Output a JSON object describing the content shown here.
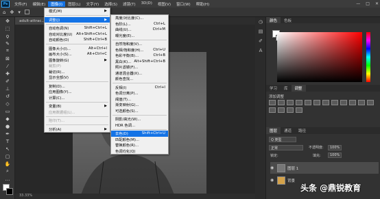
{
  "menubar": {
    "app_icon": "Ps",
    "items": [
      "文件(F)",
      "编辑(E)",
      "图像(I)",
      "图层(L)",
      "文字(Y)",
      "选择(S)",
      "滤镜(T)",
      "3D(D)",
      "视图(V)",
      "窗口(W)",
      "帮助(H)"
    ],
    "active_index": 2,
    "window_controls": [
      "—",
      "□",
      "✕"
    ]
  },
  "document": {
    "tab_label": "adult-attrac...",
    "status": "33.33%"
  },
  "image_menu": [
    {
      "label": "模式(M)",
      "submenu": true
    },
    {
      "sep": true
    },
    {
      "label": "调整(J)",
      "submenu": true,
      "selected": true
    },
    {
      "sep": true
    },
    {
      "label": "自动色调(N)",
      "key": "Shift+Ctrl+L"
    },
    {
      "label": "自动对比度(U)",
      "key": "Alt+Shift+Ctrl+L"
    },
    {
      "label": "自动颜色(O)",
      "key": "Shift+Ctrl+B"
    },
    {
      "sep": true
    },
    {
      "label": "图像大小(I)...",
      "key": "Alt+Ctrl+I"
    },
    {
      "label": "画布大小(S)...",
      "key": "Alt+Ctrl+C"
    },
    {
      "label": "图像旋转(G)",
      "submenu": true
    },
    {
      "label": "裁剪(P)",
      "disabled": true
    },
    {
      "label": "裁切(R)..."
    },
    {
      "label": "显示全部(V)"
    },
    {
      "sep": true
    },
    {
      "label": "复制(D)..."
    },
    {
      "label": "应用图像(Y)..."
    },
    {
      "label": "计算(C)..."
    },
    {
      "sep": true
    },
    {
      "label": "变量(B)",
      "submenu": true
    },
    {
      "label": "应用数据组(L)...",
      "disabled": true
    },
    {
      "sep": true
    },
    {
      "label": "陷印(T)...",
      "disabled": true
    },
    {
      "sep": true
    },
    {
      "label": "分析(A)",
      "submenu": true
    }
  ],
  "adjust_menu": [
    {
      "label": "亮度/对比度(C)..."
    },
    {
      "label": "色阶(L)...",
      "key": "Ctrl+L"
    },
    {
      "label": "曲线(U)...",
      "key": "Ctrl+M"
    },
    {
      "label": "曝光度(E)..."
    },
    {
      "sep": true
    },
    {
      "label": "自然饱和度(V)..."
    },
    {
      "label": "色相/饱和度(H)...",
      "key": "Ctrl+U"
    },
    {
      "label": "色彩平衡(B)...",
      "key": "Ctrl+B"
    },
    {
      "label": "黑白(K)...",
      "key": "Alt+Shift+Ctrl+B"
    },
    {
      "label": "照片滤镜(F)..."
    },
    {
      "label": "通道混合器(X)..."
    },
    {
      "label": "颜色查找..."
    },
    {
      "sep": true
    },
    {
      "label": "反相(I)",
      "key": "Ctrl+I"
    },
    {
      "label": "色调分离(P)..."
    },
    {
      "label": "阈值(T)..."
    },
    {
      "label": "渐变映射(G)..."
    },
    {
      "label": "可选颜色(S)..."
    },
    {
      "sep": true
    },
    {
      "label": "阴影/高光(W)..."
    },
    {
      "label": "HDR 色调..."
    },
    {
      "sep": true
    },
    {
      "label": "去色(D)",
      "key": "Shift+Ctrl+U",
      "selected": true
    },
    {
      "label": "匹配颜色(M)..."
    },
    {
      "label": "替换颜色(R)..."
    },
    {
      "label": "色调均化(Q)"
    }
  ],
  "panels": {
    "color_tabs": [
      "颜色",
      "色板"
    ],
    "adj_tabs": [
      "学习",
      "库",
      "调整"
    ],
    "adj_title": "添加调整",
    "layer_tabs": [
      "图层",
      "通道",
      "路径"
    ],
    "kind_label": "Q 类型",
    "blend_mode": "正常",
    "opacity_label": "不透明度:",
    "opacity_value": "100%",
    "lock_label": "锁定:",
    "fill_label": "填充:",
    "fill_value": "100%",
    "layers": [
      "图层 1",
      "背景"
    ]
  },
  "watermark": "头条 @鼎锐教育"
}
